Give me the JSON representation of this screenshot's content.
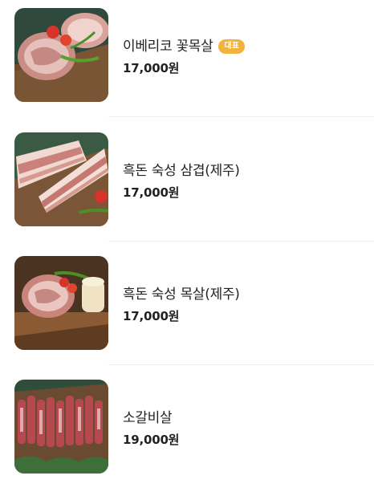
{
  "menu": {
    "items": [
      {
        "name": "이베리코 꽃목살",
        "price": "17,000원",
        "badge": "대표"
      },
      {
        "name": "흑돈 숙성 삼겹(제주)",
        "price": "17,000원",
        "badge": ""
      },
      {
        "name": "흑돈 숙성 목살(제주)",
        "price": "17,000원",
        "badge": ""
      },
      {
        "name": "소갈비살",
        "price": "19,000원",
        "badge": ""
      }
    ]
  },
  "colors": {
    "badge_bg": "#f2b33d",
    "text": "#222222",
    "divider": "#eeeeee"
  }
}
